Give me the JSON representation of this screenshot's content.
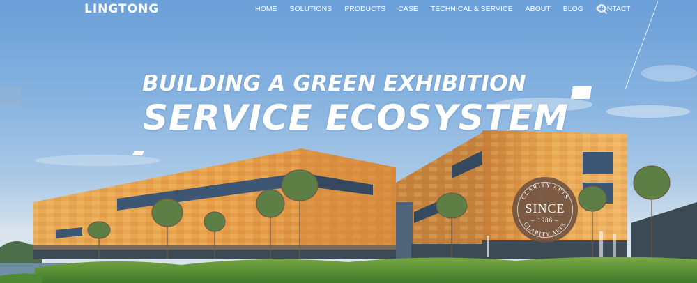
{
  "header": {
    "logo": "LINGTONG",
    "nav": [
      {
        "label": "HOME"
      },
      {
        "label": "SOLUTIONS"
      },
      {
        "label": "PRODUCTS"
      },
      {
        "label": "CASE"
      },
      {
        "label": "TECHNICAL & SERVICE"
      },
      {
        "label": "ABOUT"
      },
      {
        "label": "BLOG"
      },
      {
        "label": "CONTACT"
      }
    ],
    "search_icon": "search-icon"
  },
  "hero": {
    "headline_line1": "BUILDING A GREEN EXHIBITION",
    "headline_line2": "SERVICE  ECOSYSTEM"
  },
  "badge": {
    "arc_top": "CLARITY ARTS",
    "since": "SINCE",
    "year": "– 1986 –",
    "arc_bottom": "CLARITY ARTS"
  },
  "colors": {
    "sky": "#7fa9d6",
    "facade": "#e6a24a",
    "grass": "#5f9a3a",
    "badge": "#705242",
    "text": "#ffffff"
  }
}
